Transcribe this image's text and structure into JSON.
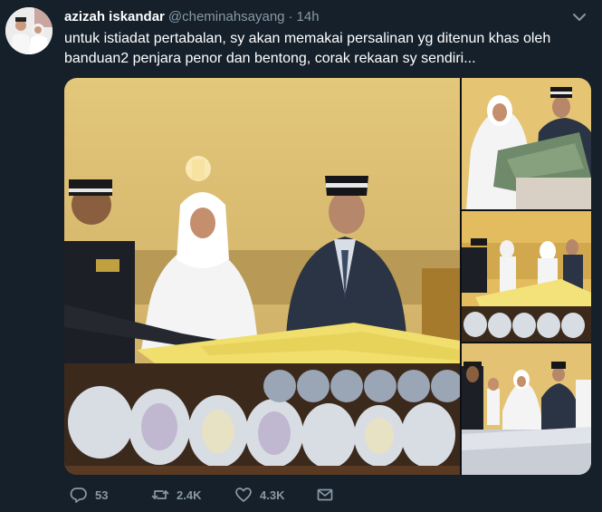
{
  "user": {
    "display_name": "azizah iskandar",
    "handle": "@cheminahsayang",
    "separator": "·",
    "time": "14h"
  },
  "tweet": {
    "text": "untuk istiadat pertabalan, sy akan memakai persalinan yg ditenun khas oleh banduan2 penjara penor dan bentong, corak rekaan sy sendiri..."
  },
  "actions": {
    "reply_count": "53",
    "retweet_count": "2.4K",
    "like_count": "4.3K"
  },
  "icons": {
    "avatar": "profile-photo",
    "caret": "chevron-down-icon",
    "reply": "reply-icon",
    "retweet": "retweet-icon",
    "like": "heart-icon",
    "share": "share-envelope-icon"
  },
  "colors": {
    "background": "#15202b",
    "text": "#ffffff",
    "secondary_text": "#8899a6"
  }
}
